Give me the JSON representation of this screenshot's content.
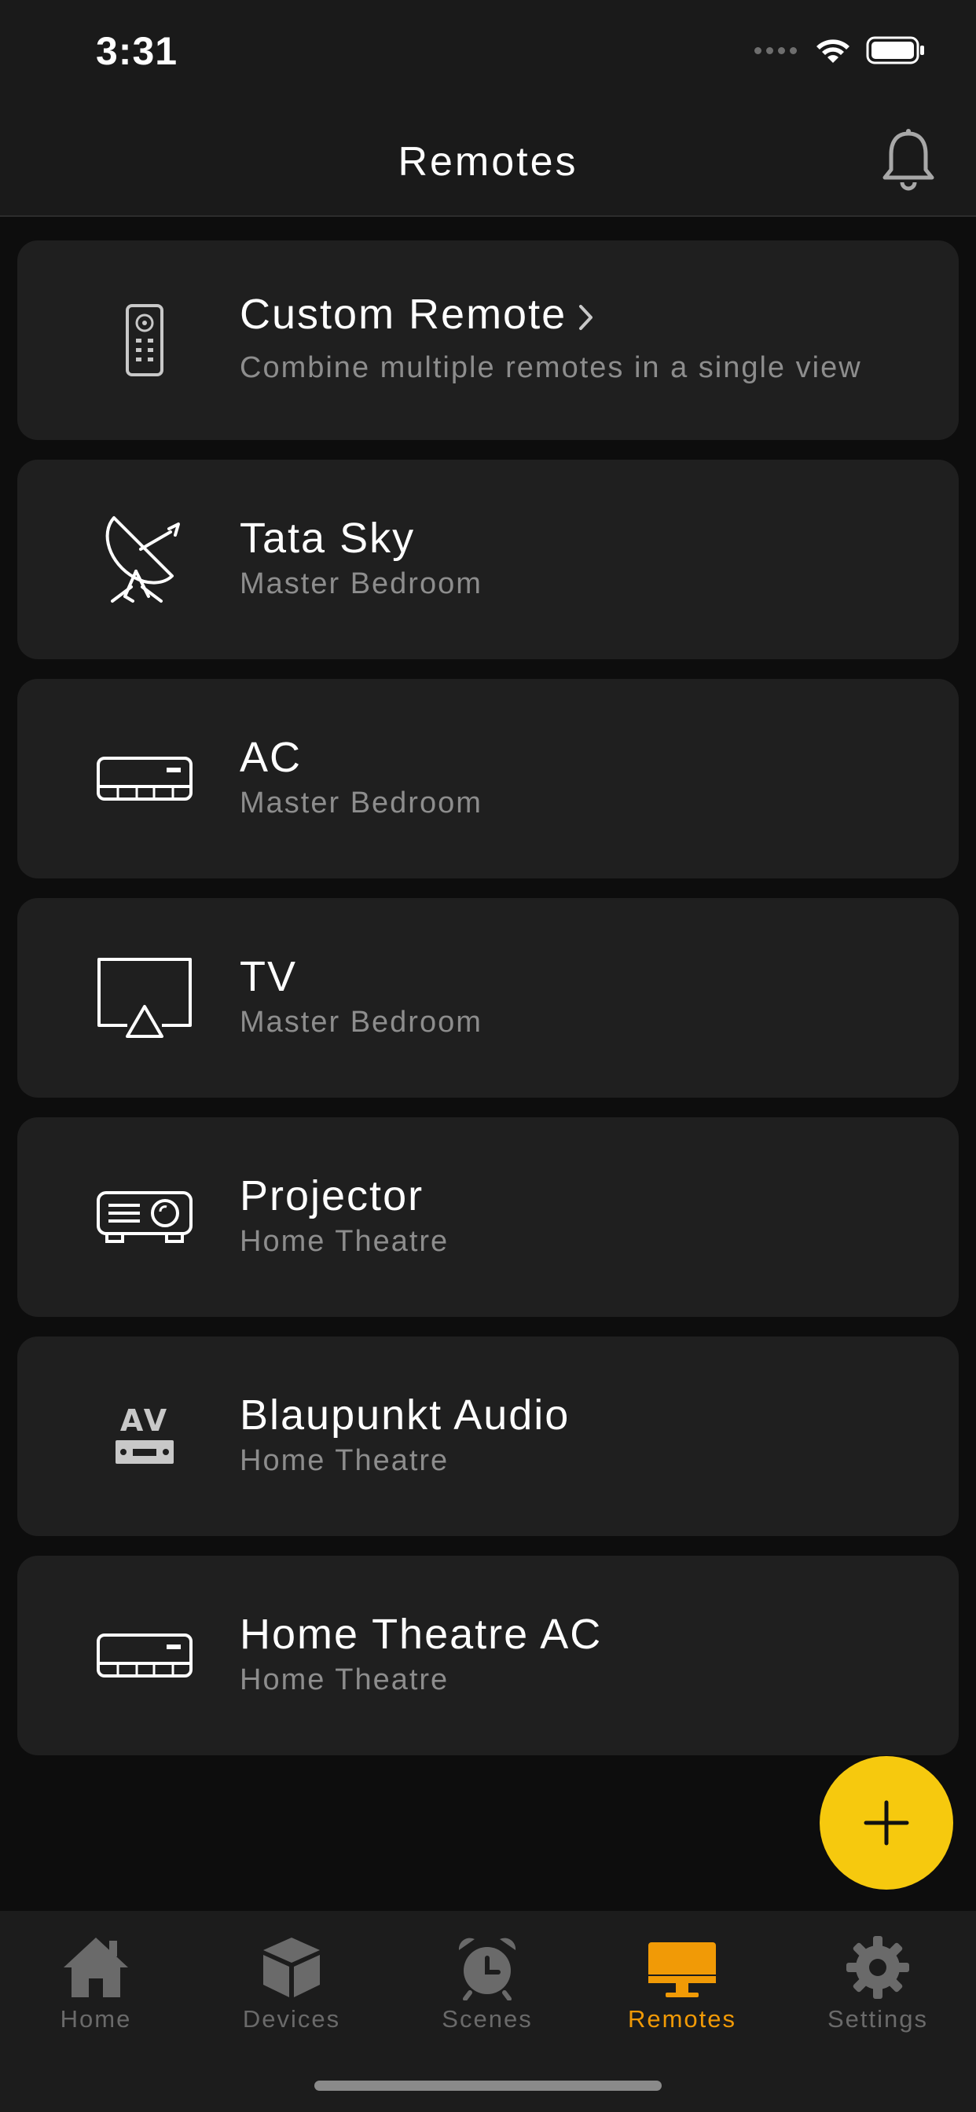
{
  "status_bar": {
    "time": "3:31"
  },
  "header": {
    "title": "Remotes"
  },
  "remotes": [
    {
      "title": "Custom Remote",
      "subtitle": "Combine multiple remotes in a single view",
      "icon": "remote-control-icon"
    },
    {
      "title": "Tata Sky",
      "subtitle": "Master Bedroom",
      "icon": "satellite-dish-icon"
    },
    {
      "title": "AC",
      "subtitle": "Master Bedroom",
      "icon": "air-conditioner-icon"
    },
    {
      "title": "TV",
      "subtitle": "Master Bedroom",
      "icon": "tv-icon"
    },
    {
      "title": "Projector",
      "subtitle": "Home Theatre",
      "icon": "projector-icon"
    },
    {
      "title": "Blaupunkt Audio",
      "subtitle": "Home Theatre",
      "icon": "av-receiver-icon",
      "icon_text": "AV"
    },
    {
      "title": "Home Theatre AC",
      "subtitle": "Home Theatre",
      "icon": "air-conditioner-icon"
    }
  ],
  "fab": {
    "icon": "plus-icon"
  },
  "tabs": [
    {
      "label": "Home",
      "icon": "home-icon",
      "active": false
    },
    {
      "label": "Devices",
      "icon": "cube-icon",
      "active": false
    },
    {
      "label": "Scenes",
      "icon": "alarm-clock-icon",
      "active": false
    },
    {
      "label": "Remotes",
      "icon": "monitor-icon",
      "active": true
    },
    {
      "label": "Settings",
      "icon": "gear-icon",
      "active": false
    }
  ],
  "colors": {
    "accent": "#f6c90e",
    "active_tab": "#f19a06",
    "card": "#1f1f1f",
    "background": "#0d0d0d"
  }
}
